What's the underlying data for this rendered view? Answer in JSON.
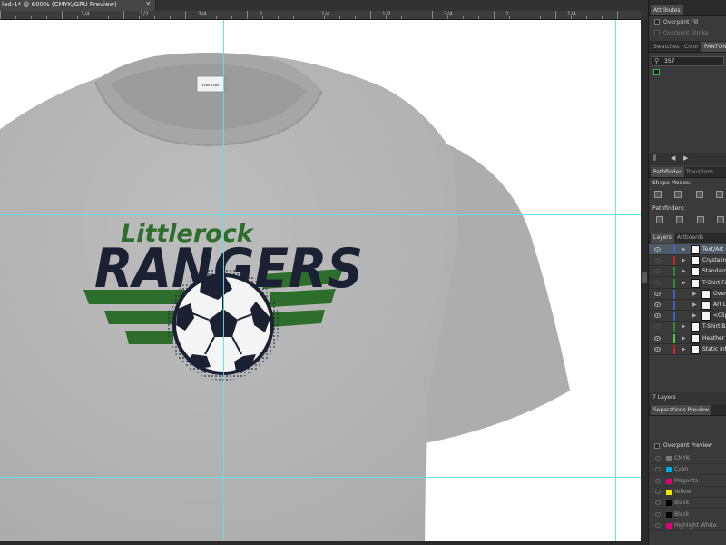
{
  "document": {
    "tab_title": "led-1* @ 600% (CMYK/GPU Preview)",
    "close_glyph": "✕"
  },
  "ruler": {
    "labels": [
      "1/4",
      "1/2",
      "3/4",
      "1",
      "1/4",
      "1/2",
      "3/4",
      "2",
      "1/4"
    ]
  },
  "artwork": {
    "team_line1": "Littlerock",
    "team_line2": "RANGERS",
    "tag_label": "Fine Line",
    "colors": {
      "shirt": "#b3b3b3",
      "green": "#2e6e2c",
      "navy": "#1b2133",
      "guide": "#5fe0ea"
    }
  },
  "panels": {
    "attributes": {
      "title": "Attributes",
      "overprint_fill": "Overprint Fill",
      "overprint_stroke": "Overprint Stroke"
    },
    "swatch_tabs": [
      "Swatches",
      "Color",
      "PANTONE"
    ],
    "swatch_search_value": "357",
    "pathfinder_tabs": [
      "Pathfinder",
      "Transform"
    ],
    "shape_modes_label": "Shape Modes:",
    "pathfinders_label": "Pathfinders:",
    "layers_tabs": [
      "Layers",
      "Artboards"
    ],
    "layers": [
      {
        "name": "Text/Art",
        "color": "#3a63c8",
        "selected": true,
        "visible": true,
        "locked": false
      },
      {
        "name": "Crystalina",
        "color": "#d02020",
        "selected": false,
        "visible": false,
        "locked": false
      },
      {
        "name": "Standard I",
        "color": "#2d8a2d",
        "selected": false,
        "visible": false,
        "locked": false
      },
      {
        "name": "T-Shirt Fro",
        "color": "#2d8a2d",
        "selected": false,
        "visible": false,
        "locked": false
      },
      {
        "name": "Overl",
        "color": "#3a63c8",
        "selected": false,
        "visible": true,
        "locked": false
      },
      {
        "name": "Art La",
        "color": "#3a63c8",
        "selected": false,
        "visible": true,
        "locked": false
      },
      {
        "name": "<Clip",
        "color": "#3a63c8",
        "selected": false,
        "visible": true,
        "locked": false
      },
      {
        "name": "T-Shirt Ba",
        "color": "#2d8a2d",
        "selected": false,
        "visible": false,
        "locked": false
      },
      {
        "name": "Heather H",
        "color": "#3fcf3f",
        "selected": false,
        "visible": true,
        "locked": false
      },
      {
        "name": "Static Info",
        "color": "#d02020",
        "selected": false,
        "visible": true,
        "locked": false
      }
    ],
    "layers_count": "7 Layers",
    "separations": {
      "title": "Separations Preview",
      "overprint_preview": "Overprint Preview",
      "items": [
        {
          "name": "CMYK",
          "color": "#777777"
        },
        {
          "name": "Cyan",
          "color": "#00a8e0"
        },
        {
          "name": "Magenta",
          "color": "#e0007a"
        },
        {
          "name": "Yellow",
          "color": "#f2e600"
        },
        {
          "name": "Black",
          "color": "#000000"
        },
        {
          "name": "Black",
          "color": "#000000"
        },
        {
          "name": "Highlight White",
          "color": "#e0007a"
        }
      ]
    }
  }
}
